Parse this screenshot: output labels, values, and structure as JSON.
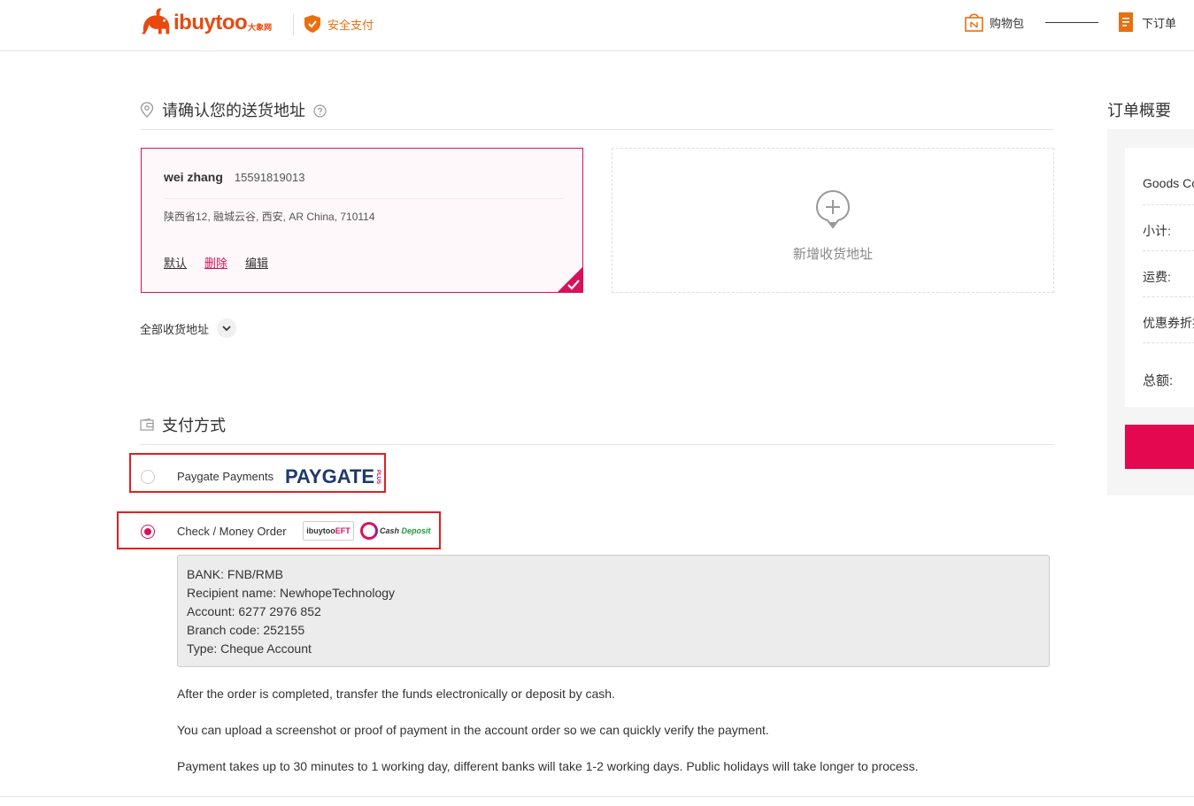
{
  "header": {
    "logo_text": "ibuytoo",
    "logo_cn": "大象网",
    "secure_label": "安全支付",
    "cart_label": "购物包",
    "order_label": "下订单"
  },
  "address_section": {
    "title": "请确认您的送货地址",
    "card": {
      "name": "wei zhang",
      "phone": "15591819013",
      "address": "陕西省12, 融城云谷, 西安, AR China, 710114",
      "actions": {
        "default": "默认",
        "delete": "删除",
        "edit": "编辑"
      }
    },
    "add_label": "新增收货地址",
    "all_addresses": "全部收货地址"
  },
  "payment_section": {
    "title": "支付方式",
    "options": [
      {
        "label": "Paygate Payments",
        "logo": "PAYGATE",
        "logo_suffix": "PLUS",
        "selected": false
      },
      {
        "label": "Check / Money Order",
        "logo_eft_a": "ibuytoo",
        "logo_eft_b": "EFT",
        "logo_cash_a": "Cash ",
        "logo_cash_b": "Deposit",
        "selected": true
      }
    ],
    "bank_details": [
      "BANK: FNB/RMB",
      "Recipient name: NewhopeTechnology",
      "Account: 6277 2976 852",
      "Branch code: 252155",
      "Type: Cheque Account"
    ],
    "notes": [
      "After the order is completed, transfer the funds electronically or deposit by cash.",
      "You can upload a screenshot or proof of payment in the account order so we can quickly verify the payment.",
      "Payment takes up to 30 minutes to 1 working day, different banks will take 1-2 working days. Public holidays will take longer to process."
    ]
  },
  "summary": {
    "title": "订单概要",
    "rows": [
      "Goods Cost:",
      "小计:",
      "运费:",
      "优惠券折扣:",
      "总额:"
    ]
  },
  "colors": {
    "brand": "#e8490f",
    "accent": "#d8115b",
    "highlight_border": "#e02020",
    "button": "#e3084f"
  }
}
